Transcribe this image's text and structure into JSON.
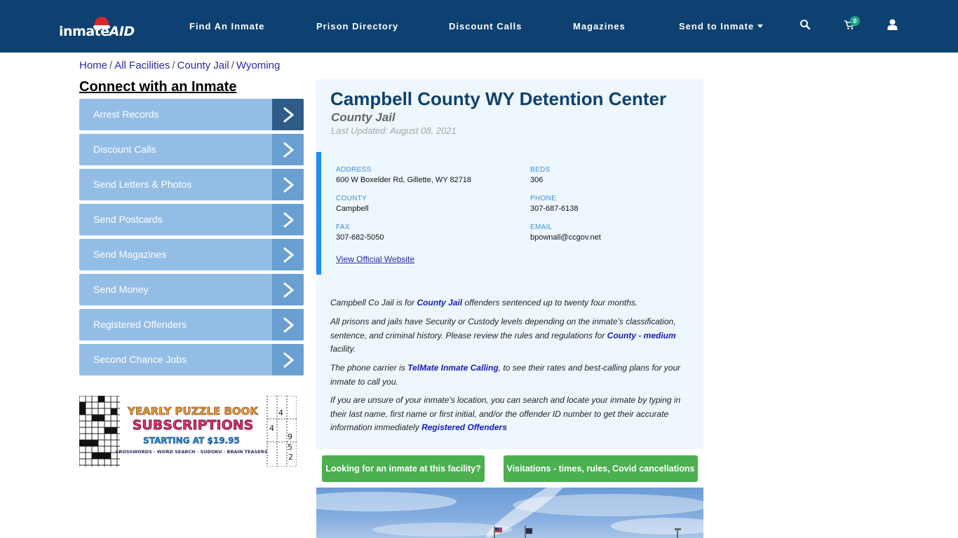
{
  "header": {
    "logo_text": "inmate",
    "logo_text_accent": "AID",
    "nav": [
      {
        "label": "Find An Inmate"
      },
      {
        "label": "Prison Directory"
      },
      {
        "label": "Discount Calls"
      },
      {
        "label": "Magazines"
      },
      {
        "label": "Send to Inmate",
        "has_dropdown": true
      }
    ],
    "icons": [
      "search-icon",
      "cart-icon",
      "user-icon"
    ],
    "cart_count": "0"
  },
  "breadcrumb": [
    {
      "label": "Home"
    },
    {
      "label": "All Facilities"
    },
    {
      "label": "County Jail"
    },
    {
      "label": "Wyoming"
    }
  ],
  "sidebar": {
    "title": "Connect with an Inmate",
    "items": [
      {
        "label": "Arrest Records",
        "active": true
      },
      {
        "label": "Discount Calls"
      },
      {
        "label": "Send Letters & Photos"
      },
      {
        "label": "Send Postcards"
      },
      {
        "label": "Send Magazines"
      },
      {
        "label": "Send Money"
      },
      {
        "label": "Registered Offenders"
      },
      {
        "label": "Second Chance Jobs"
      }
    ],
    "ad": {
      "line1": "YEARLY PUZZLE BOOK",
      "line2": "SUBSCRIPTIONS",
      "line3": "STARTING AT $19.95",
      "line4": "CROSSWORDS · WORD SEARCH · SUDOKU · BRAIN TEASERS"
    }
  },
  "facility": {
    "name": "Campbell County WY Detention Center",
    "type": "County Jail",
    "last_updated": "Last Updated: August 08, 2021",
    "fields": {
      "address": {
        "label": "ADDRESS",
        "value": "600 W Boxelder Rd, Gillette, WY 82718"
      },
      "beds": {
        "label": "BEDS",
        "value": "306"
      },
      "county": {
        "label": "COUNTY",
        "value": "Campbell"
      },
      "phone": {
        "label": "PHONE",
        "value": "307-687-6138"
      },
      "fax": {
        "label": "FAX",
        "value": "307-682-5050"
      },
      "email": {
        "label": "EMAIL",
        "value": "bpownall@ccgov.net"
      }
    },
    "website_link": "View Official Website",
    "description": {
      "p1_a": "Campbell Co Jail is for ",
      "p1_link": "County Jail",
      "p1_b": " offenders sentenced up to twenty four months.",
      "p2_a": "All prisons and jails have Security or Custody levels depending on the inmate's classification, sentence, and criminal history. Please review the rules and regulations for ",
      "p2_link": "County - medium",
      "p2_b": " facility.",
      "p3_a": "The phone carrier is ",
      "p3_link": "TelMate Inmate Calling",
      "p3_b": ", to see their rates and best-calling plans for your inmate to call you.",
      "p4_a": "If you are unsure of your inmate's location, you can search and locate your inmate by typing in their last name, first name or first initial, and/or the offender ID number to get their accurate information immediately ",
      "p4_link": "Registered Offenders"
    },
    "buttons": {
      "find_inmate": "Looking for an inmate at this facility?",
      "visitations": "Visitations - times, rules, Covid cancellations"
    }
  },
  "colors": {
    "header_bg": "#0d4171",
    "title": "#0f416e",
    "sidebar_item": "#94bde6",
    "sidebar_arrow": "#6a9fd2",
    "sidebar_arrow_active": "#2f5b88",
    "accent_bar": "#1b8ff3",
    "button_green": "#4caf50",
    "link": "#1220b5"
  }
}
